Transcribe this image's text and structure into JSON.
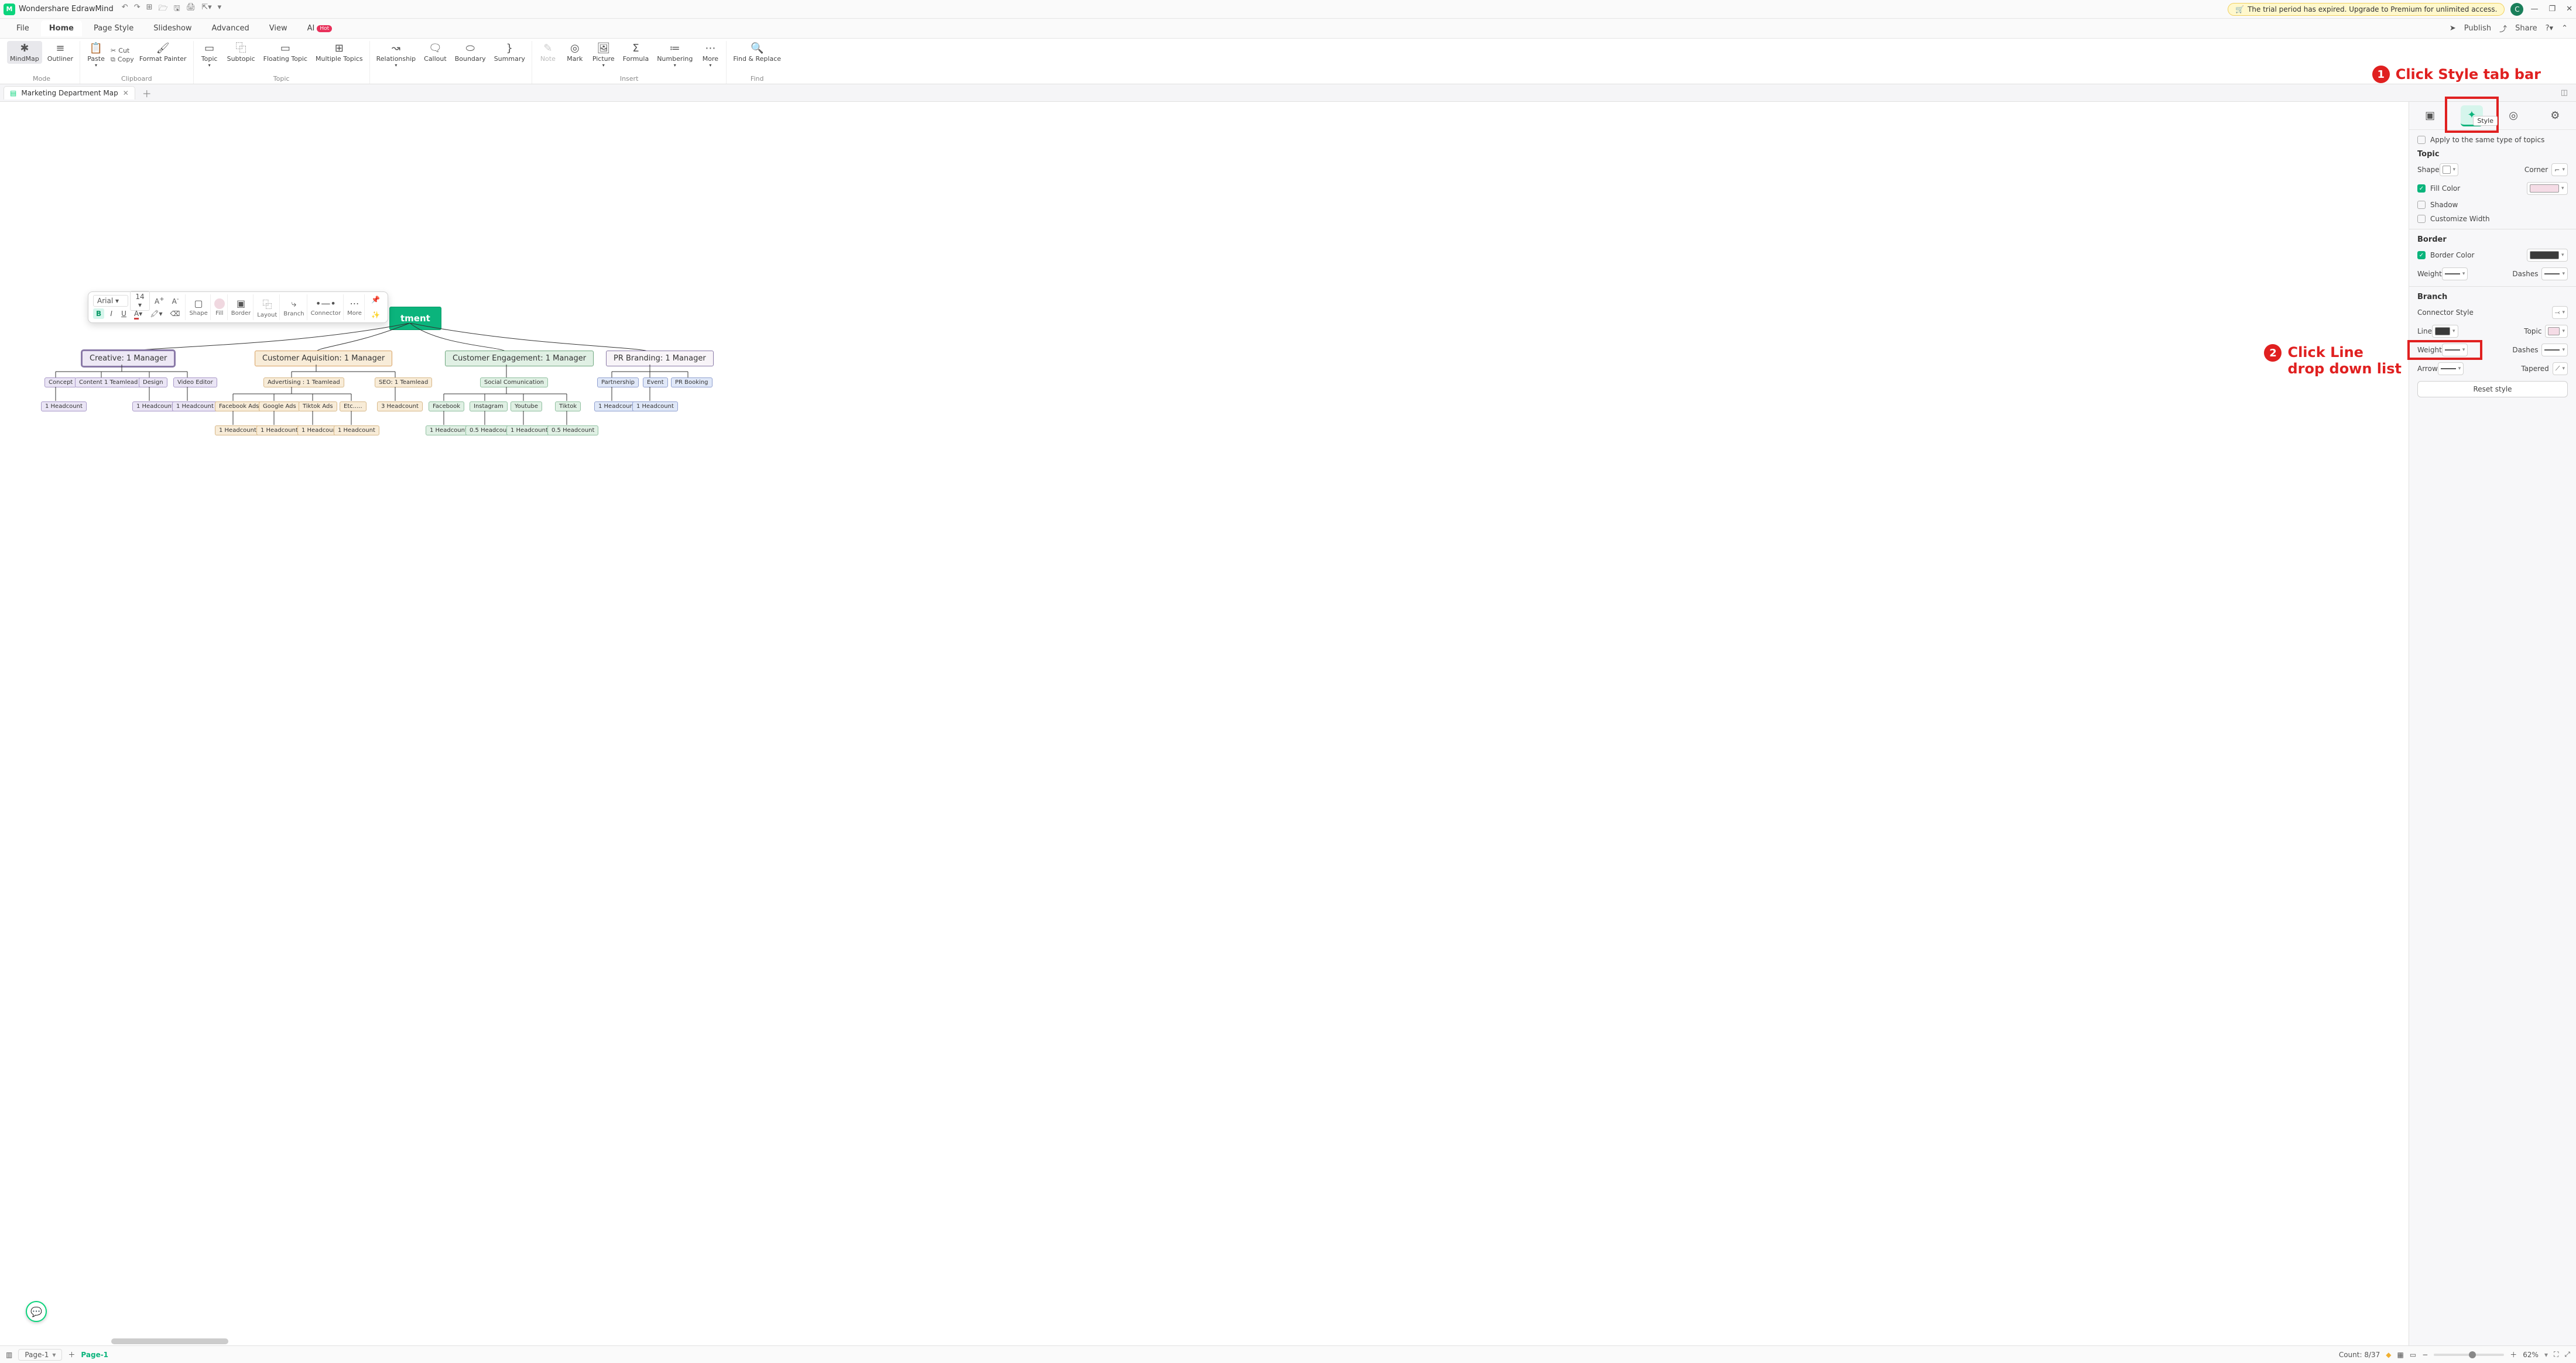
{
  "titlebar": {
    "app_name": "Wondershare EdrawMind",
    "trial_text": "The trial period has expired. Upgrade to Premium for unlimited access.",
    "avatar": "C"
  },
  "menu": {
    "file": "File",
    "home": "Home",
    "page_style": "Page Style",
    "slideshow": "Slideshow",
    "advanced": "Advanced",
    "view": "View",
    "ai": "AI",
    "ai_hot": "Hot",
    "publish": "Publish",
    "share": "Share"
  },
  "ribbon": {
    "mindmap": "MindMap",
    "outliner": "Outliner",
    "mode": "Mode",
    "paste": "Paste",
    "copy": "Copy",
    "cut": "Cut",
    "format_painter": "Format Painter",
    "clipboard": "Clipboard",
    "topic": "Topic",
    "subtopic": "Subtopic",
    "floating": "Floating Topic",
    "multiple": "Multiple Topics",
    "topic_g": "Topic",
    "relationship": "Relationship",
    "callout": "Callout",
    "boundary": "Boundary",
    "summary": "Summary",
    "note": "Note",
    "mark": "Mark",
    "picture": "Picture",
    "formula": "Formula",
    "numbering": "Numbering",
    "more": "More",
    "insert": "Insert",
    "find_replace": "Find & Replace",
    "find": "Find"
  },
  "doc": {
    "tab_name": "Marketing Department Map"
  },
  "canvas": {
    "root": "tment",
    "m1": "Creative: 1 Manager",
    "m2": "Customer Aquisition: 1 Manager",
    "m3": "Customer Engagement: 1 Manager",
    "m4": "PR Branding: 1 Manager",
    "c1": "Concept",
    "c2": "Content 1 Teamlead",
    "c3": "Design",
    "c4": "Video Editor",
    "hc1": "1 Headcount",
    "hc2": "1 Headcount",
    "hc3": "1 Headcount",
    "a1": "Advertising : 1 Teamlead",
    "a2": "SEO: 1 Teamlead",
    "fb": "Facebook Ads",
    "ga": "Google Ads",
    "tt": "Tiktok Ads",
    "etc": "Etc.....",
    "h3": "3 Headcount",
    "fbh": "1 Headcount",
    "gah": "1 Headcount",
    "tth": "1 Headcount",
    "etch": "1 Headcount",
    "sc": "Social Comunication",
    "fb2": "Facebook",
    "ig": "Instagram",
    "yt": "Youtube",
    "tk": "Tiktok",
    "fb2h": "1 Headcount",
    "igh": "0.5 Headcount",
    "yth": "1 Headcount",
    "tkh": "0.5 Headcount",
    "pr1": "Partnership",
    "pr2": "Event",
    "pr3": "PR Booking",
    "pr1h": "1 Headcount",
    "pr2h": "1 Headcount"
  },
  "floatbar": {
    "font": "Arial",
    "size": "14",
    "shape": "Shape",
    "fill": "Fill",
    "border": "Border",
    "layout": "Layout",
    "branch": "Branch",
    "connector": "Connector",
    "more": "More"
  },
  "rpanel": {
    "style_tooltip": "Style",
    "apply_same": "Apply to the same type of topics",
    "topic": "Topic",
    "shape": "Shape",
    "corner": "Corner",
    "fill_color": "Fill Color",
    "shadow": "Shadow",
    "custom_width": "Customize Width",
    "border": "Border",
    "border_color": "Border Color",
    "weight": "Weight",
    "dashes": "Dashes",
    "branch": "Branch",
    "connector_style": "Connector Style",
    "line": "Line",
    "topic2": "Topic",
    "weight2": "Weight",
    "dashes2": "Dashes",
    "arrow": "Arrow",
    "tapered": "Tapered",
    "reset": "Reset style"
  },
  "annotations": {
    "a1": "Click Style tab bar",
    "a2a": "Click Line",
    "a2b": "drop down list"
  },
  "status": {
    "page_sel": "Page-1",
    "page_active": "Page-1",
    "count": "Count: 8/37",
    "zoom": "62%"
  }
}
